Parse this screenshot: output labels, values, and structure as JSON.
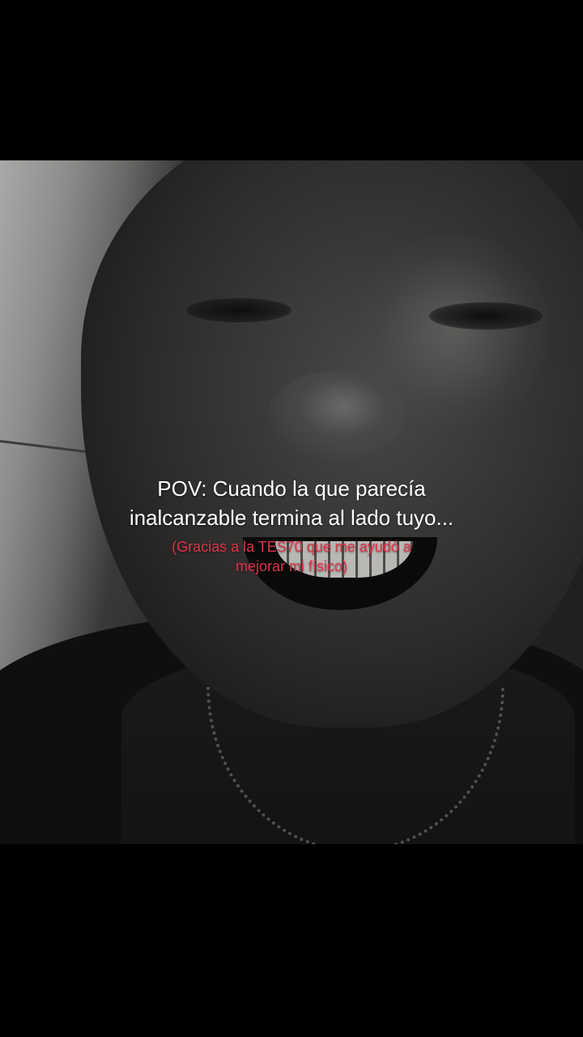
{
  "caption": {
    "main": "POV: Cuando la que parecía inalcanzable termina al lado tuyo...",
    "sub": "(Gracias a la TES70 que me ayudó a mejorar mi físico)"
  },
  "colors": {
    "caption_main": "#ffffff",
    "caption_sub": "#e0344a",
    "background": "#000000"
  }
}
